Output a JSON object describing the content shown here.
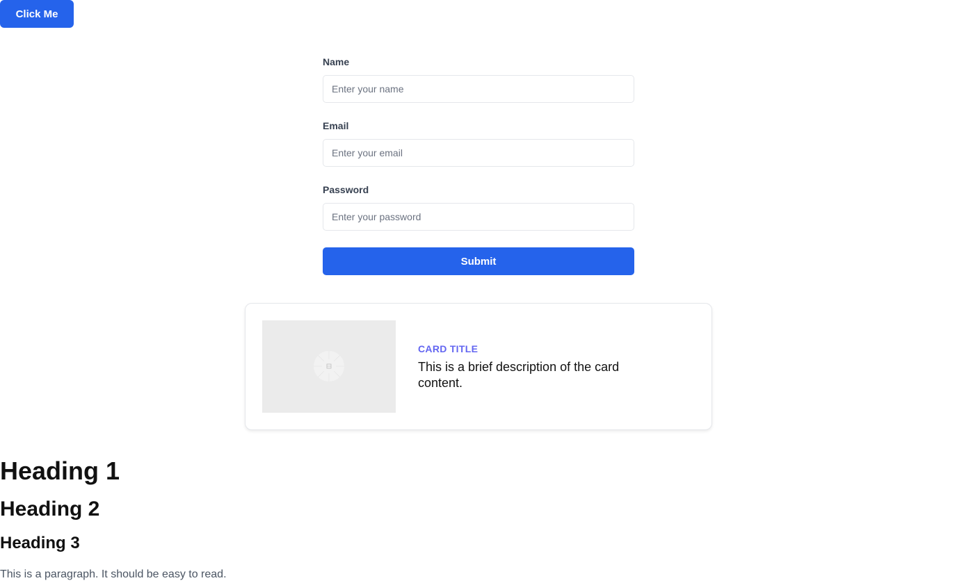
{
  "top_button": {
    "label": "Click Me"
  },
  "form": {
    "fields": [
      {
        "label": "Name",
        "placeholder": "Enter your name",
        "value": ""
      },
      {
        "label": "Email",
        "placeholder": "Enter your email",
        "value": ""
      },
      {
        "label": "Password",
        "placeholder": "Enter your password",
        "value": ""
      }
    ],
    "submit_label": "Submit"
  },
  "card": {
    "title": "CARD TITLE",
    "description": "This is a brief description of the card content.",
    "image_icon": "image-placeholder-icon"
  },
  "typography": {
    "heading1": "Heading 1",
    "heading2": "Heading 2",
    "heading3": "Heading 3",
    "paragraph": "This is a paragraph. It should be easy to read."
  },
  "colors": {
    "primary": "#2563eb",
    "card_title": "#6366f1",
    "label_text": "#374151",
    "paragraph_text": "#4b5563"
  }
}
